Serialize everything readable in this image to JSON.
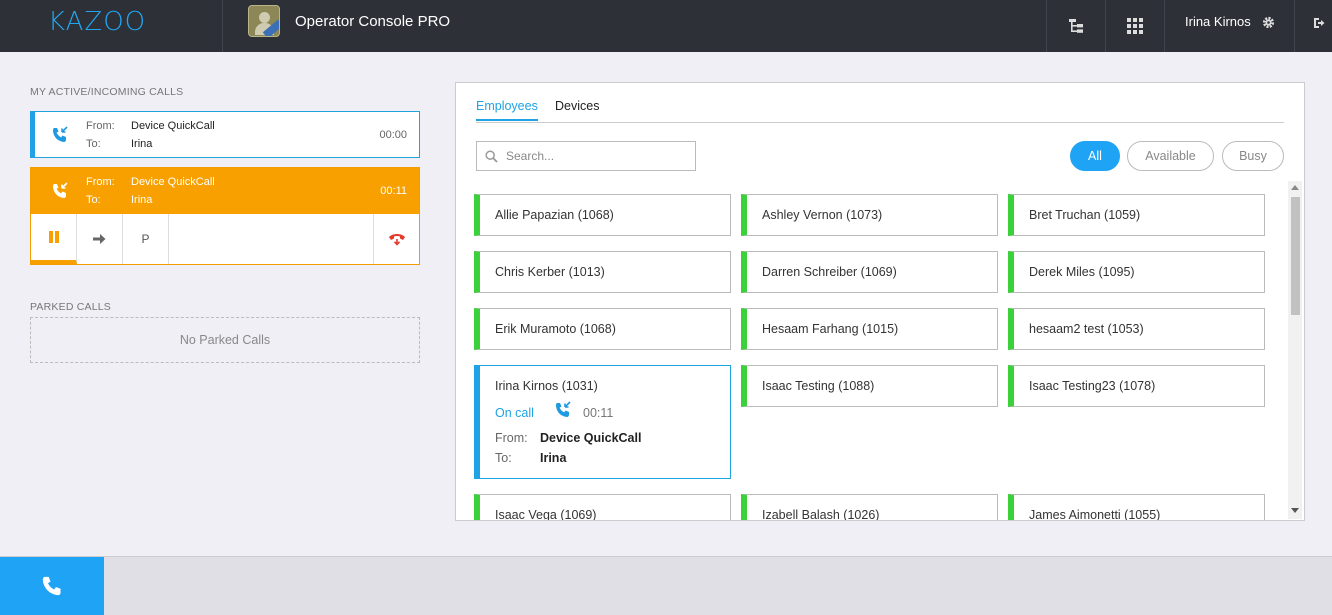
{
  "header": {
    "logo": "KAZOO",
    "app_title": "Operator Console PRO",
    "user_name": "Irina Kirnos"
  },
  "active_calls": {
    "section_label": "MY ACTIVE/INCOMING CALLS",
    "calls": [
      {
        "from_label": "From:",
        "from": "Device QuickCall",
        "to_label": "To:",
        "to": "Irina",
        "time": "00:00"
      },
      {
        "from_label": "From:",
        "from": "Device QuickCall",
        "to_label": "To:",
        "to": "Irina",
        "time": "00:11"
      }
    ],
    "park_label": "P"
  },
  "parked": {
    "section_label": "PARKED CALLS",
    "empty_text": "No Parked Calls"
  },
  "directory": {
    "tabs": [
      {
        "label": "Employees"
      },
      {
        "label": "Devices"
      }
    ],
    "search_placeholder": "Search...",
    "filters": [
      {
        "label": "All"
      },
      {
        "label": "Available"
      },
      {
        "label": "Busy"
      }
    ],
    "employees": [
      {
        "name": "Allie Papazian (1068)"
      },
      {
        "name": "Ashley Vernon (1073)"
      },
      {
        "name": "Bret Truchan (1059)"
      },
      {
        "name": "Chris Kerber (1013)"
      },
      {
        "name": "Darren Schreiber (1069)"
      },
      {
        "name": "Derek Miles (1095)"
      },
      {
        "name": "Erik Muramoto (1068)"
      },
      {
        "name": "Hesaam Farhang (1015)"
      },
      {
        "name": "hesaam2 test (1053)"
      },
      {
        "name": "Irina Kirnos (1031)",
        "status": "On call",
        "time": "00:11",
        "from_label": "From:",
        "from": "Device QuickCall",
        "to_label": "To:",
        "to": "Irina"
      },
      {
        "name": "Isaac Testing (1088)"
      },
      {
        "name": "Isaac Testing23 (1078)"
      },
      {
        "name": "Isaac Vega (1069)"
      },
      {
        "name": "Izabell Balash (1026)"
      },
      {
        "name": "James Aimonetti (1055)"
      }
    ]
  },
  "colors": {
    "accent": "#1fa3f5",
    "topbar": "#2d3037",
    "incoming": "#f8a000",
    "available": "#3bd13b",
    "hangup": "#e53a2a"
  }
}
